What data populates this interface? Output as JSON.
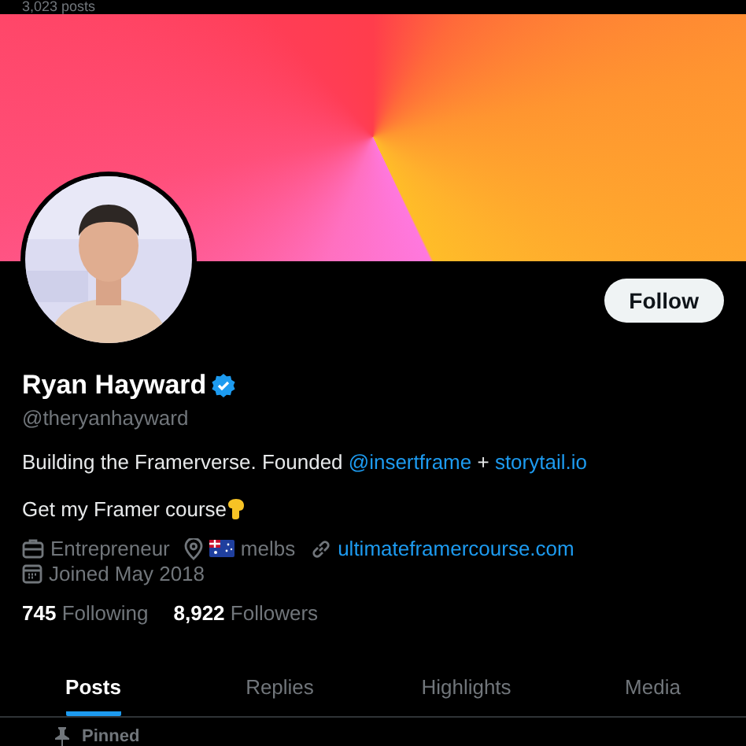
{
  "header": {
    "post_count": "3,023 posts"
  },
  "profile": {
    "name": "Ryan Hayward",
    "verified": true,
    "handle": "@theryanhayward",
    "follow_button": "Follow",
    "bio": [
      {
        "kind": "text",
        "text": "Building the Framerverse. Founded "
      },
      {
        "kind": "link",
        "text": "@insertframe"
      },
      {
        "kind": "text",
        "text": " + "
      },
      {
        "kind": "link",
        "text": "storytail.io"
      }
    ],
    "bio_line_2": "Get my Framer course",
    "meta": [
      {
        "kind": "job",
        "text": "Entrepreneur"
      },
      {
        "kind": "location",
        "text": "melbs"
      },
      {
        "kind": "link",
        "text": "ultimateframercourse.com"
      },
      {
        "kind": "joined",
        "text": "Joined May 2018"
      }
    ],
    "stats": [
      {
        "count": "745",
        "label": "Following"
      },
      {
        "count": "8,922",
        "label": "Followers"
      }
    ]
  },
  "tabs": [
    {
      "label": "Posts",
      "selected": true
    },
    {
      "label": "Replies",
      "selected": false
    },
    {
      "label": "Highlights",
      "selected": false
    },
    {
      "label": "Media",
      "selected": false
    }
  ],
  "pinned": "Pinned"
}
